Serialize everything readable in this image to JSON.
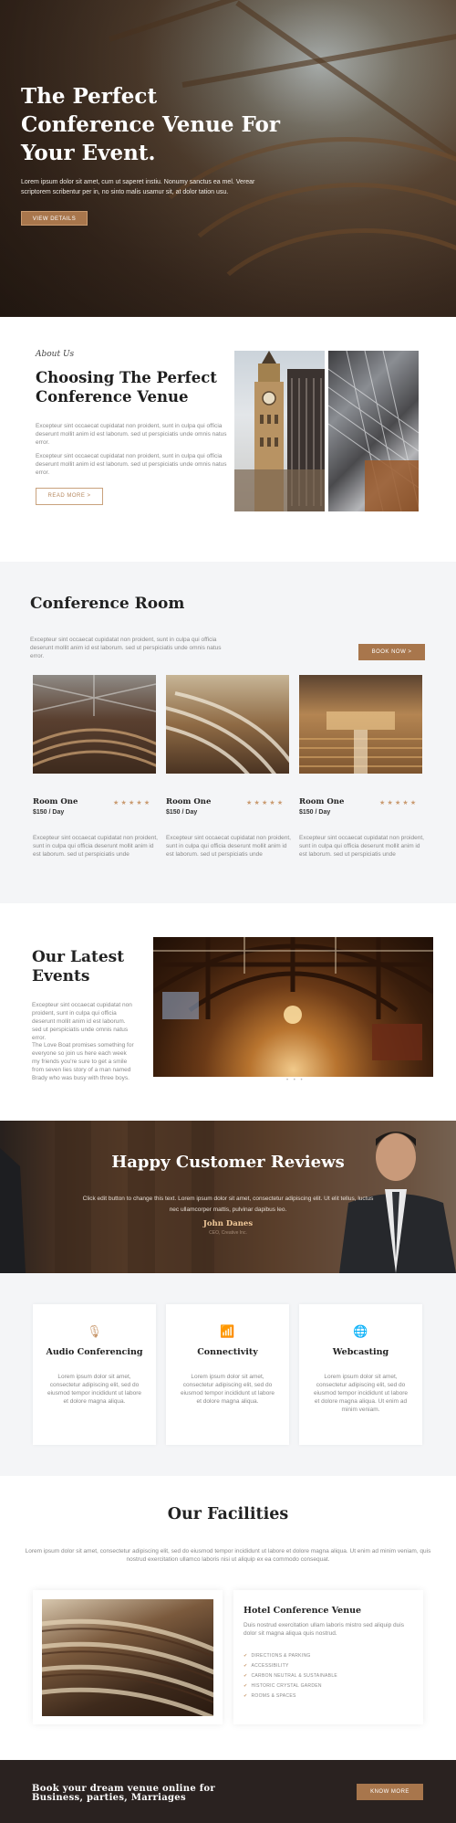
{
  "hero": {
    "title": "The Perfect Conference Venue For Your Event.",
    "text": "Lorem ipsum dolor sit amet, cum ut saperet instiu. Nonumy sanctus ea mel. Verear scriptorem scribentur per in, no sinto malis usamur sit, at dolor tation usu.",
    "button": "VIEW DETAILS"
  },
  "about": {
    "eyebrow": "About Us",
    "title": "Choosing The Perfect Conference Venue",
    "p1": "Excepteur sint occaecat cupidatat non proident, sunt in culpa qui officia deserunt mollit anim id est laborum. sed ut perspiciatis unde omnis natus error.",
    "p2": "Excepteur sint occaecat cupidatat non proident, sunt in culpa qui officia deserunt mollit anim id est laborum. sed ut perspiciatis unde omnis natus error.",
    "button": "READ MORE >"
  },
  "conference": {
    "title": "Conference Room",
    "desc": "Excepteur sint occaecat cupidatat non proident, sunt in culpa qui officia deserunt mollit anim id est laborum. sed ut perspiciatis unde omnis natus error.",
    "button": "BOOK NOW >",
    "rooms": [
      {
        "name": "Room One",
        "price": "$150 / Day",
        "rating": 5,
        "desc": "Excepteur sint occaecat cupidatat non proident, sunt in culpa qui officia deserunt mollit anim id est laborum. sed ut perspiciatis unde"
      },
      {
        "name": "Room One",
        "price": "$150 / Day",
        "rating": 5,
        "desc": "Excepteur sint occaecat cupidatat non proident, sunt in culpa qui officia deserunt mollit anim id est laborum. sed ut perspiciatis unde"
      },
      {
        "name": "Room One",
        "price": "$150 / Day",
        "rating": 5,
        "desc": "Excepteur sint occaecat cupidatat non proident, sunt in culpa qui officia deserunt mollit anim id est laborum. sed ut perspiciatis unde"
      }
    ]
  },
  "events": {
    "title": "Our Latest Events",
    "p1": "Excepteur sint occaecat cupidatat non proident, sunt in culpa qui officia deserunt mollit anim id est laborum. sed ut perspiciatis unde omnis natus error.",
    "p2": "The Love Boat promises something for everyone so join us here each week my friends you're sure to get a smile from seven lies story of a man named Brady who was busy with three boys."
  },
  "reviews": {
    "title": "Happy Customer Reviews",
    "quote": "Click edit button to change this text. Lorem ipsum dolor sit amet, consectetur adipiscing elit. Ut elit tellus, luctus nec ullamcorper mattis, pulvinar dapibus leo.",
    "name": "John Danes",
    "role": "CEO, Creative Inc."
  },
  "services": [
    {
      "icon": "microphone-icon",
      "glyph": "🎙",
      "title": "Audio Conferencing",
      "text": "Lorem ipsum dolor sit amet, consectetur adipiscing elit, sed do eiusmod tempor incididunt ut labore et dolore magna aliqua."
    },
    {
      "icon": "wifi-icon",
      "glyph": "📶",
      "title": "Connectivity",
      "text": "Lorem ipsum dolor sit amet, consectetur adipiscing elit, sed do eiusmod tempor incididunt ut labore et dolore magna aliqua."
    },
    {
      "icon": "globe-icon",
      "glyph": "🌐",
      "title": "Webcasting",
      "text": "Lorem ipsum dolor sit amet, consectetur adipiscing elit, sed do eiusmod tempor incididunt ut labore et dolore magna aliqua. Ut enim ad minim veniam."
    }
  ],
  "facilities": {
    "title": "Our Facilities",
    "desc": "Lorem ipsum dolor sit amet, consectetur adipiscing elit, sed do eiusmod tempor incididunt ut labore et dolore magna aliqua. Ut enim ad minim veniam, quis nostrud exercitation ullamco laboris nisi ut aliquip ex ea commodo consequat.",
    "card_title": "Hotel Conference Venue",
    "card_sub": "Duis nostrud exercitation ullam laboris mistro sed aliquip duis dolor sit magna aliqua quis nostrud.",
    "list": [
      "DIRECTIONS & PARKING",
      "ACCESSIBILITY",
      "CARBON NEUTRAL & SUSTAINABLE",
      "HISTORIC CRYSTAL GARDEN",
      "ROOMS & SPACES"
    ]
  },
  "cta": {
    "text_line1": "Book your dream venue online for",
    "text_line2": "Business, parties, Marriages",
    "button": "KNOW MORE"
  },
  "colors": {
    "accent": "#a8764c",
    "gold": "#c99a6f",
    "dark": "#2a2220",
    "light_bg": "#f4f5f7"
  }
}
